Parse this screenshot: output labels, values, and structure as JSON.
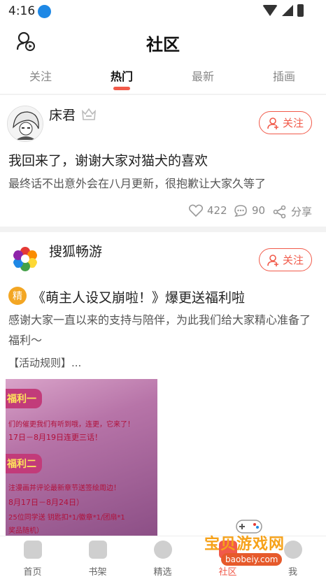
{
  "status_bar": {
    "time": "4:16"
  },
  "header": {
    "title": "社区"
  },
  "tabs": [
    {
      "label": "关注"
    },
    {
      "label": "热门"
    },
    {
      "label": "最新"
    },
    {
      "label": "插画"
    }
  ],
  "posts": [
    {
      "author": "床君",
      "follow_label": "关注",
      "title": "我回来了，谢谢大家对猫犬的喜欢",
      "body": "最终话不出意外会在八月更新，很抱歉让大家久等了",
      "likes": "422",
      "comments": "90",
      "share_label": "分享"
    },
    {
      "author": "搜狐畅游",
      "follow_label": "关注",
      "badge": "精",
      "title": "《萌主人设又崩啦！》爆更送福利啦",
      "body": "感谢大家一直以来的支持与陪伴，为此我们给大家精心准备了福利～",
      "rule": "【活动规则】...",
      "image": {
        "tag1": "福利一",
        "line1": "们的催更我们有听到哦，连更，它来了！",
        "line2": "17日－8月19日连更三话！",
        "tag2": "福利二",
        "line3": "注漫画并评论最新章节送签绘周边！",
        "line4": "8月17日－8月24日）",
        "line5": "25位同学送 钥匙扣*1/徽章*1/团扇*1",
        "line6": "奖品随机）"
      }
    }
  ],
  "bottom_nav": [
    {
      "label": "首页"
    },
    {
      "label": "书架"
    },
    {
      "label": "精选"
    },
    {
      "label": "社区"
    },
    {
      "label": "我"
    }
  ],
  "watermark": {
    "text": "宝贝游戏网",
    "url": "baobeiy.com"
  },
  "colors": {
    "accent": "#f15a4a",
    "badge": "#f3a623"
  }
}
